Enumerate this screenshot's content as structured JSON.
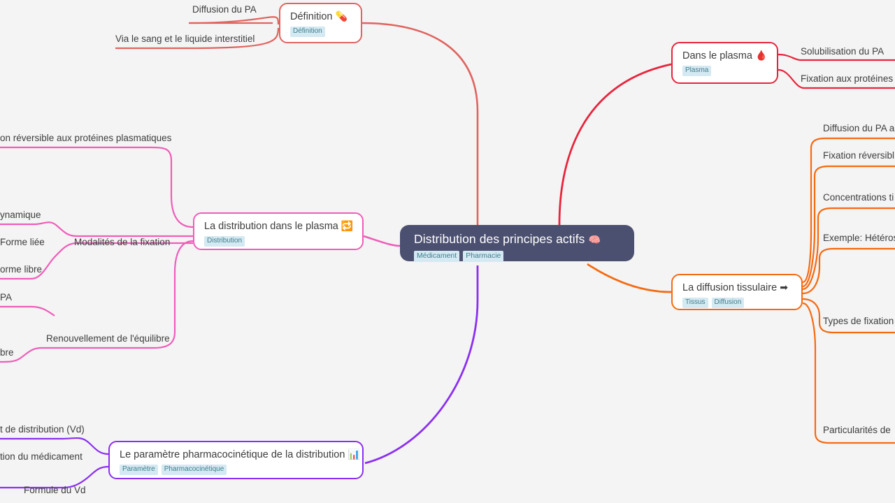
{
  "central": {
    "title": "Distribution des principes actifs",
    "emoji": "🧠",
    "tags": [
      "Médicament",
      "Pharmacie"
    ]
  },
  "branches": [
    {
      "id": "definition",
      "title": "Définition",
      "emoji": "💊",
      "tags": [
        "Définition"
      ],
      "color": "#e0645f",
      "leaves": [
        "Diffusion du PA",
        "Via le sang et le liquide interstitiel"
      ]
    },
    {
      "id": "plasma",
      "title": "Dans le plasma",
      "emoji": "🩸",
      "tags": [
        "Plasma"
      ],
      "color": "#e8243c",
      "leaves": [
        "Solubilisation du PA",
        "Fixation aux protéines"
      ]
    },
    {
      "id": "distribution-plasma",
      "title": "La distribution dans le plasma",
      "emoji": "🔁",
      "tags": [
        "Distribution"
      ],
      "color": "#ef5dba",
      "leaves": [
        "on réversible aux protéines plasmatiques",
        "ynamique",
        "Forme liée",
        "Modalités de la fixation",
        "orme libre",
        "PA",
        "Renouvellement de l'équilibre",
        "bre"
      ]
    },
    {
      "id": "diffusion-tissulaire",
      "title": "La diffusion tissulaire",
      "emoji": "➡",
      "tags": [
        "Tissus",
        "Diffusion"
      ],
      "color": "#f56a10",
      "leaves": [
        "Diffusion du PA a",
        "Fixation réversibl",
        "Concentrations ti",
        "Exemple: Hétéros",
        "Types de fixation",
        "Particularités de"
      ]
    },
    {
      "id": "parametre-pk",
      "title": "Le paramètre pharmacocinétique de la distribution",
      "emoji": "📊",
      "tags": [
        "Paramètre",
        "Pharmacocinétique"
      ],
      "color": "#8b2ff0",
      "leaves": [
        "t de distribution (Vd)",
        "tion du médicament",
        "Formule du Vd"
      ]
    }
  ],
  "colors": {
    "background": "#f4f4f4",
    "central_bg": "#4c5070",
    "tag_bg": "#d4e9f2",
    "tag_text": "#3f7f8c",
    "label_text": "#3d3d3d"
  }
}
